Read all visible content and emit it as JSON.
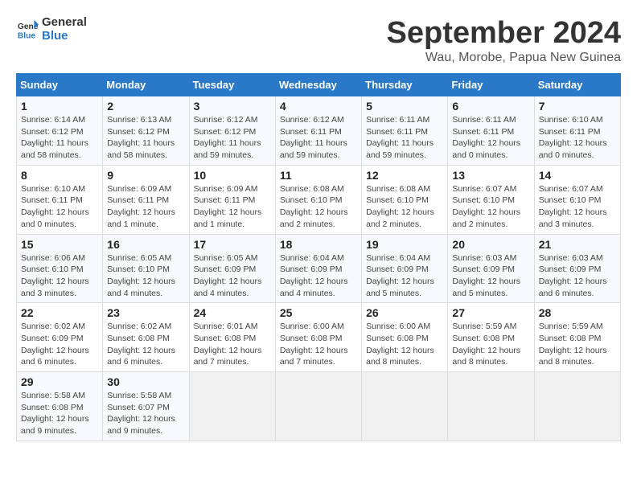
{
  "header": {
    "logo_line1": "General",
    "logo_line2": "Blue",
    "month": "September 2024",
    "location": "Wau, Morobe, Papua New Guinea"
  },
  "weekdays": [
    "Sunday",
    "Monday",
    "Tuesday",
    "Wednesday",
    "Thursday",
    "Friday",
    "Saturday"
  ],
  "weeks": [
    [
      {
        "num": "1",
        "info": "Sunrise: 6:14 AM\nSunset: 6:12 PM\nDaylight: 11 hours\nand 58 minutes."
      },
      {
        "num": "2",
        "info": "Sunrise: 6:13 AM\nSunset: 6:12 PM\nDaylight: 11 hours\nand 58 minutes."
      },
      {
        "num": "3",
        "info": "Sunrise: 6:12 AM\nSunset: 6:12 PM\nDaylight: 11 hours\nand 59 minutes."
      },
      {
        "num": "4",
        "info": "Sunrise: 6:12 AM\nSunset: 6:11 PM\nDaylight: 11 hours\nand 59 minutes."
      },
      {
        "num": "5",
        "info": "Sunrise: 6:11 AM\nSunset: 6:11 PM\nDaylight: 11 hours\nand 59 minutes."
      },
      {
        "num": "6",
        "info": "Sunrise: 6:11 AM\nSunset: 6:11 PM\nDaylight: 12 hours\nand 0 minutes."
      },
      {
        "num": "7",
        "info": "Sunrise: 6:10 AM\nSunset: 6:11 PM\nDaylight: 12 hours\nand 0 minutes."
      }
    ],
    [
      {
        "num": "8",
        "info": "Sunrise: 6:10 AM\nSunset: 6:11 PM\nDaylight: 12 hours\nand 0 minutes."
      },
      {
        "num": "9",
        "info": "Sunrise: 6:09 AM\nSunset: 6:11 PM\nDaylight: 12 hours\nand 1 minute."
      },
      {
        "num": "10",
        "info": "Sunrise: 6:09 AM\nSunset: 6:11 PM\nDaylight: 12 hours\nand 1 minute."
      },
      {
        "num": "11",
        "info": "Sunrise: 6:08 AM\nSunset: 6:10 PM\nDaylight: 12 hours\nand 2 minutes."
      },
      {
        "num": "12",
        "info": "Sunrise: 6:08 AM\nSunset: 6:10 PM\nDaylight: 12 hours\nand 2 minutes."
      },
      {
        "num": "13",
        "info": "Sunrise: 6:07 AM\nSunset: 6:10 PM\nDaylight: 12 hours\nand 2 minutes."
      },
      {
        "num": "14",
        "info": "Sunrise: 6:07 AM\nSunset: 6:10 PM\nDaylight: 12 hours\nand 3 minutes."
      }
    ],
    [
      {
        "num": "15",
        "info": "Sunrise: 6:06 AM\nSunset: 6:10 PM\nDaylight: 12 hours\nand 3 minutes."
      },
      {
        "num": "16",
        "info": "Sunrise: 6:05 AM\nSunset: 6:10 PM\nDaylight: 12 hours\nand 4 minutes."
      },
      {
        "num": "17",
        "info": "Sunrise: 6:05 AM\nSunset: 6:09 PM\nDaylight: 12 hours\nand 4 minutes."
      },
      {
        "num": "18",
        "info": "Sunrise: 6:04 AM\nSunset: 6:09 PM\nDaylight: 12 hours\nand 4 minutes."
      },
      {
        "num": "19",
        "info": "Sunrise: 6:04 AM\nSunset: 6:09 PM\nDaylight: 12 hours\nand 5 minutes."
      },
      {
        "num": "20",
        "info": "Sunrise: 6:03 AM\nSunset: 6:09 PM\nDaylight: 12 hours\nand 5 minutes."
      },
      {
        "num": "21",
        "info": "Sunrise: 6:03 AM\nSunset: 6:09 PM\nDaylight: 12 hours\nand 6 minutes."
      }
    ],
    [
      {
        "num": "22",
        "info": "Sunrise: 6:02 AM\nSunset: 6:09 PM\nDaylight: 12 hours\nand 6 minutes."
      },
      {
        "num": "23",
        "info": "Sunrise: 6:02 AM\nSunset: 6:08 PM\nDaylight: 12 hours\nand 6 minutes."
      },
      {
        "num": "24",
        "info": "Sunrise: 6:01 AM\nSunset: 6:08 PM\nDaylight: 12 hours\nand 7 minutes."
      },
      {
        "num": "25",
        "info": "Sunrise: 6:00 AM\nSunset: 6:08 PM\nDaylight: 12 hours\nand 7 minutes."
      },
      {
        "num": "26",
        "info": "Sunrise: 6:00 AM\nSunset: 6:08 PM\nDaylight: 12 hours\nand 8 minutes."
      },
      {
        "num": "27",
        "info": "Sunrise: 5:59 AM\nSunset: 6:08 PM\nDaylight: 12 hours\nand 8 minutes."
      },
      {
        "num": "28",
        "info": "Sunrise: 5:59 AM\nSunset: 6:08 PM\nDaylight: 12 hours\nand 8 minutes."
      }
    ],
    [
      {
        "num": "29",
        "info": "Sunrise: 5:58 AM\nSunset: 6:08 PM\nDaylight: 12 hours\nand 9 minutes."
      },
      {
        "num": "30",
        "info": "Sunrise: 5:58 AM\nSunset: 6:07 PM\nDaylight: 12 hours\nand 9 minutes."
      },
      {
        "num": "",
        "info": ""
      },
      {
        "num": "",
        "info": ""
      },
      {
        "num": "",
        "info": ""
      },
      {
        "num": "",
        "info": ""
      },
      {
        "num": "",
        "info": ""
      }
    ]
  ]
}
